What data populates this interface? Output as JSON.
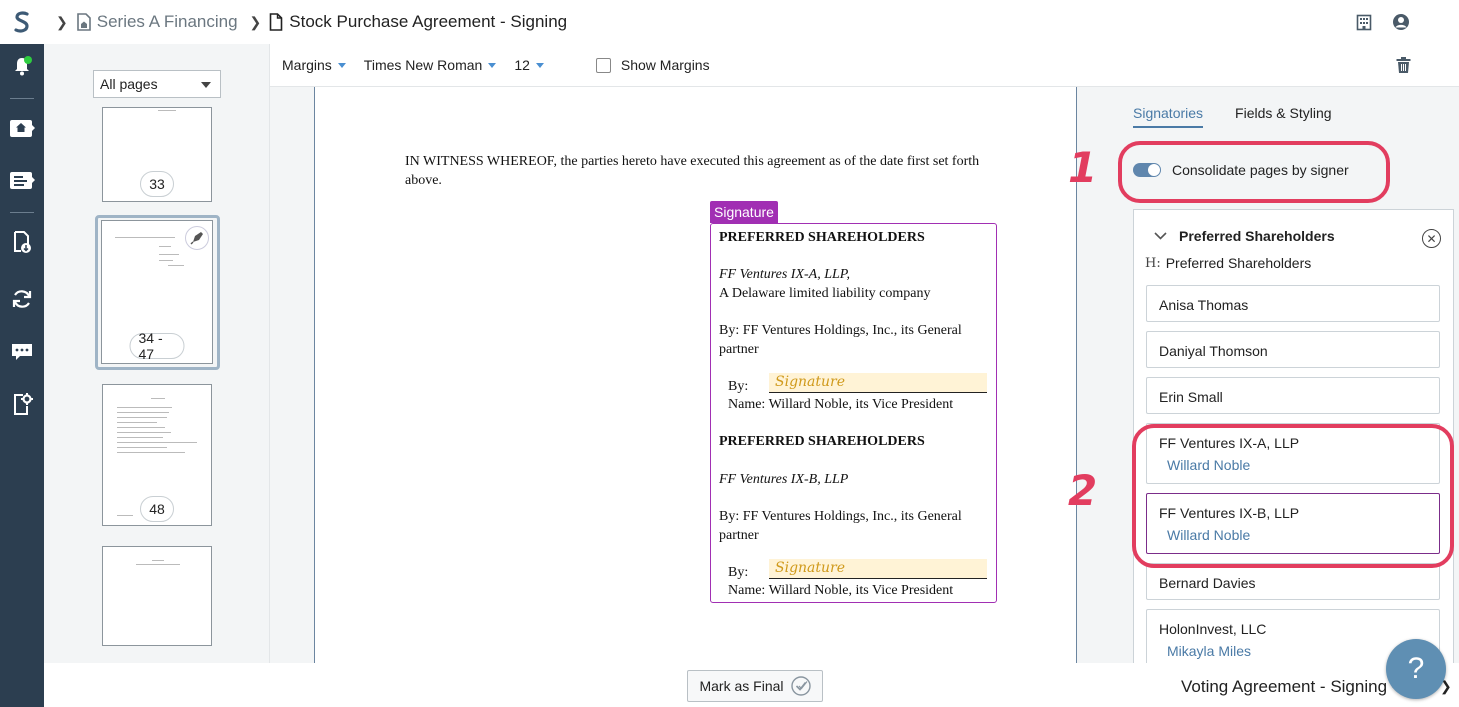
{
  "breadcrumb": {
    "folder": "Series A Financing",
    "document": "Stock Purchase Agreement - Signing"
  },
  "thumbnails": {
    "filter": "All pages",
    "pages": [
      {
        "label": "33"
      },
      {
        "label": "34 - 47"
      },
      {
        "label": "48"
      },
      {
        "label": ""
      }
    ]
  },
  "toolbar": {
    "margins": "Margins",
    "font": "Times New Roman",
    "size": "12",
    "show_margins": "Show Margins"
  },
  "document": {
    "witness": "IN WITNESS WHEREOF, the parties hereto have executed this agreement as of the date first set forth above.",
    "sig_tag": "Signature",
    "block1": {
      "heading": "PREFERRED SHAREHOLDERS",
      "entity": "FF Ventures IX-A, LLP,",
      "entity_desc": "A Delaware limited liability company",
      "by": "By: FF Ventures Holdings, Inc., its General partner",
      "by_label": "By:",
      "sig_placeholder": "Signature",
      "name_line": "Name: Willard Noble, its Vice President"
    },
    "block2": {
      "heading": "PREFERRED SHAREHOLDERS",
      "entity": "FF Ventures IX-B, LLP",
      "by": "By: FF Ventures Holdings, Inc., its General partner",
      "by_label": "By:",
      "sig_placeholder": "Signature",
      "name_line": "Name: Willard Noble, its Vice President"
    }
  },
  "panel": {
    "tab_signatories": "Signatories",
    "tab_fields": "Fields & Styling",
    "consolidate_label": "Consolidate pages by signer",
    "annotation_1": "1",
    "annotation_2": "2",
    "group_title": "Preferred Shareholders",
    "group_subtitle": "Preferred Shareholders",
    "signers": [
      {
        "name": "Anisa Thomas",
        "sub": ""
      },
      {
        "name": "Daniyal Thomson",
        "sub": ""
      },
      {
        "name": "Erin Small",
        "sub": ""
      },
      {
        "name": "FF Ventures IX-A, LLP",
        "sub": "Willard Noble"
      },
      {
        "name": "FF Ventures IX-B, LLP",
        "sub": "Willard Noble"
      },
      {
        "name": "Bernard Davies",
        "sub": ""
      },
      {
        "name": "HolonInvest, LLC",
        "sub": "Mikayla Miles"
      }
    ]
  },
  "bottom": {
    "mark_final": "Mark as Final",
    "next_doc": "Voting Agreement - Signing -"
  },
  "help": "?",
  "colors": {
    "rail": "#2c3e50",
    "accent": "#4a7aa6",
    "signature": "#a12fb3",
    "annotation": "#e23d5f"
  }
}
